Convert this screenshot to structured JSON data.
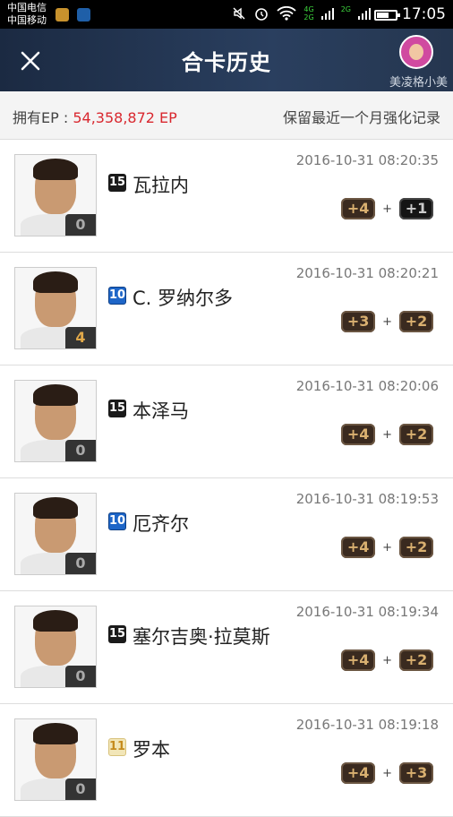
{
  "status_bar": {
    "carrier_1": "中国电信",
    "carrier_2": "中国移动",
    "net_1": "4G",
    "net_2": "2G",
    "net_3": "2G",
    "time": "17:05",
    "battery_level": 0.58
  },
  "header": {
    "title": "合卡历史",
    "username": "美凌格小美"
  },
  "ep_bar": {
    "label": "拥有EP : ",
    "value": "54,358,872 EP",
    "note": "保留最近一个月强化记录"
  },
  "records": [
    {
      "season": "15",
      "season_style": "black",
      "name": "瓦拉内",
      "level": "0",
      "time": "2016-10-31 08:20:35",
      "chip1": "+4",
      "chip2": "+1",
      "chip2_style": "dark"
    },
    {
      "season": "10",
      "season_style": "blue",
      "name": "C. 罗纳尔多",
      "level": "4",
      "time": "2016-10-31 08:20:21",
      "chip1": "+3",
      "chip2": "+2",
      "chip2_style": "normal"
    },
    {
      "season": "15",
      "season_style": "black",
      "name": "本泽马",
      "level": "0",
      "time": "2016-10-31 08:20:06",
      "chip1": "+4",
      "chip2": "+2",
      "chip2_style": "normal"
    },
    {
      "season": "10",
      "season_style": "blue",
      "name": "厄齐尔",
      "level": "0",
      "time": "2016-10-31 08:19:53",
      "chip1": "+4",
      "chip2": "+2",
      "chip2_style": "normal"
    },
    {
      "season": "15",
      "season_style": "black",
      "name": "塞尔吉奥·拉莫斯",
      "level": "0",
      "time": "2016-10-31 08:19:34",
      "chip1": "+4",
      "chip2": "+2",
      "chip2_style": "normal"
    },
    {
      "season": "11",
      "season_style": "gold",
      "name": "罗本",
      "level": "0",
      "time": "2016-10-31 08:19:18",
      "chip1": "+4",
      "chip2": "+3",
      "chip2_style": "normal"
    }
  ],
  "plus_sign": "+",
  "colors": {
    "ep_value": "#d9282f",
    "header_bg": "#1b2a42"
  }
}
